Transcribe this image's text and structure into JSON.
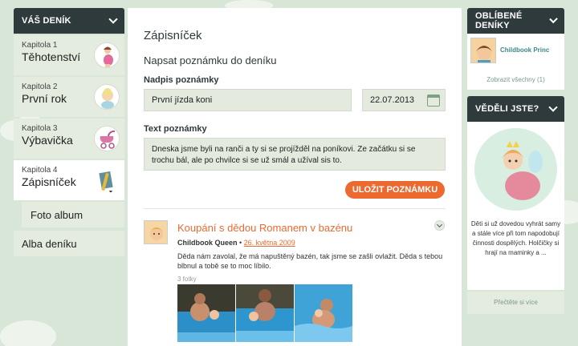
{
  "left_nav": {
    "header": "VÁŠ DENÍK",
    "chapters": [
      {
        "number_label": "Kapitola 1",
        "title": "Těhotenství"
      },
      {
        "number_label": "Kapitola 2",
        "title": "První rok"
      },
      {
        "number_label": "Kapitola 3",
        "title": "Výbavička"
      },
      {
        "number_label": "Kapitola 4",
        "title": "Zápisníček"
      }
    ],
    "sub_item": "Foto album",
    "album_label": "Alba deníku"
  },
  "main": {
    "page_title": "Zápisníček",
    "section_title": "Napsat poznámku do deníku",
    "title_label": "Nadpis poznámky",
    "title_value": "První jízda koni",
    "date_value": "22.07.2013",
    "text_label": "Text poznámky",
    "text_value": "Dneska jsme byli na ranči a ty si se projížděl na poníkovi. Ze začátku si se trochu bál, ale po chvilce si se už smál a užíval sis to.",
    "save_button": "ULOŽIT POZNÁMKU",
    "post": {
      "title": "Koupání s dědou Romanem v bazénu",
      "author": "Childbook Queen",
      "separator": " • ",
      "date": "26. května 2009",
      "text": "Děda nám zavolal, že má napuštěný bazén, tak jsme se zašli ovlažit. Děda s tebou blbnul a tobě se to moc líbilo.",
      "photo_count": "3 fotky"
    }
  },
  "right": {
    "fav_header": "OBLÍBENÉ DENÍKY",
    "fav_name": "Childbook Princ",
    "fav_all": "Zobrazit všechny (1)",
    "didyou_header": "VĚDĚLI JSTE?",
    "didyou_text": "Děti si už dovedou vyhrát samy a stále více při tom napodobují činnosti dospělých. Holčičky si hrají na maminky a ...",
    "read_more": "Přečtěte si více"
  },
  "colors": {
    "accent": "#ec6a30",
    "header_bg": "#2f3a3c",
    "page_bg": "#d8e6d7",
    "nav_bg": "#e4ecdf"
  }
}
